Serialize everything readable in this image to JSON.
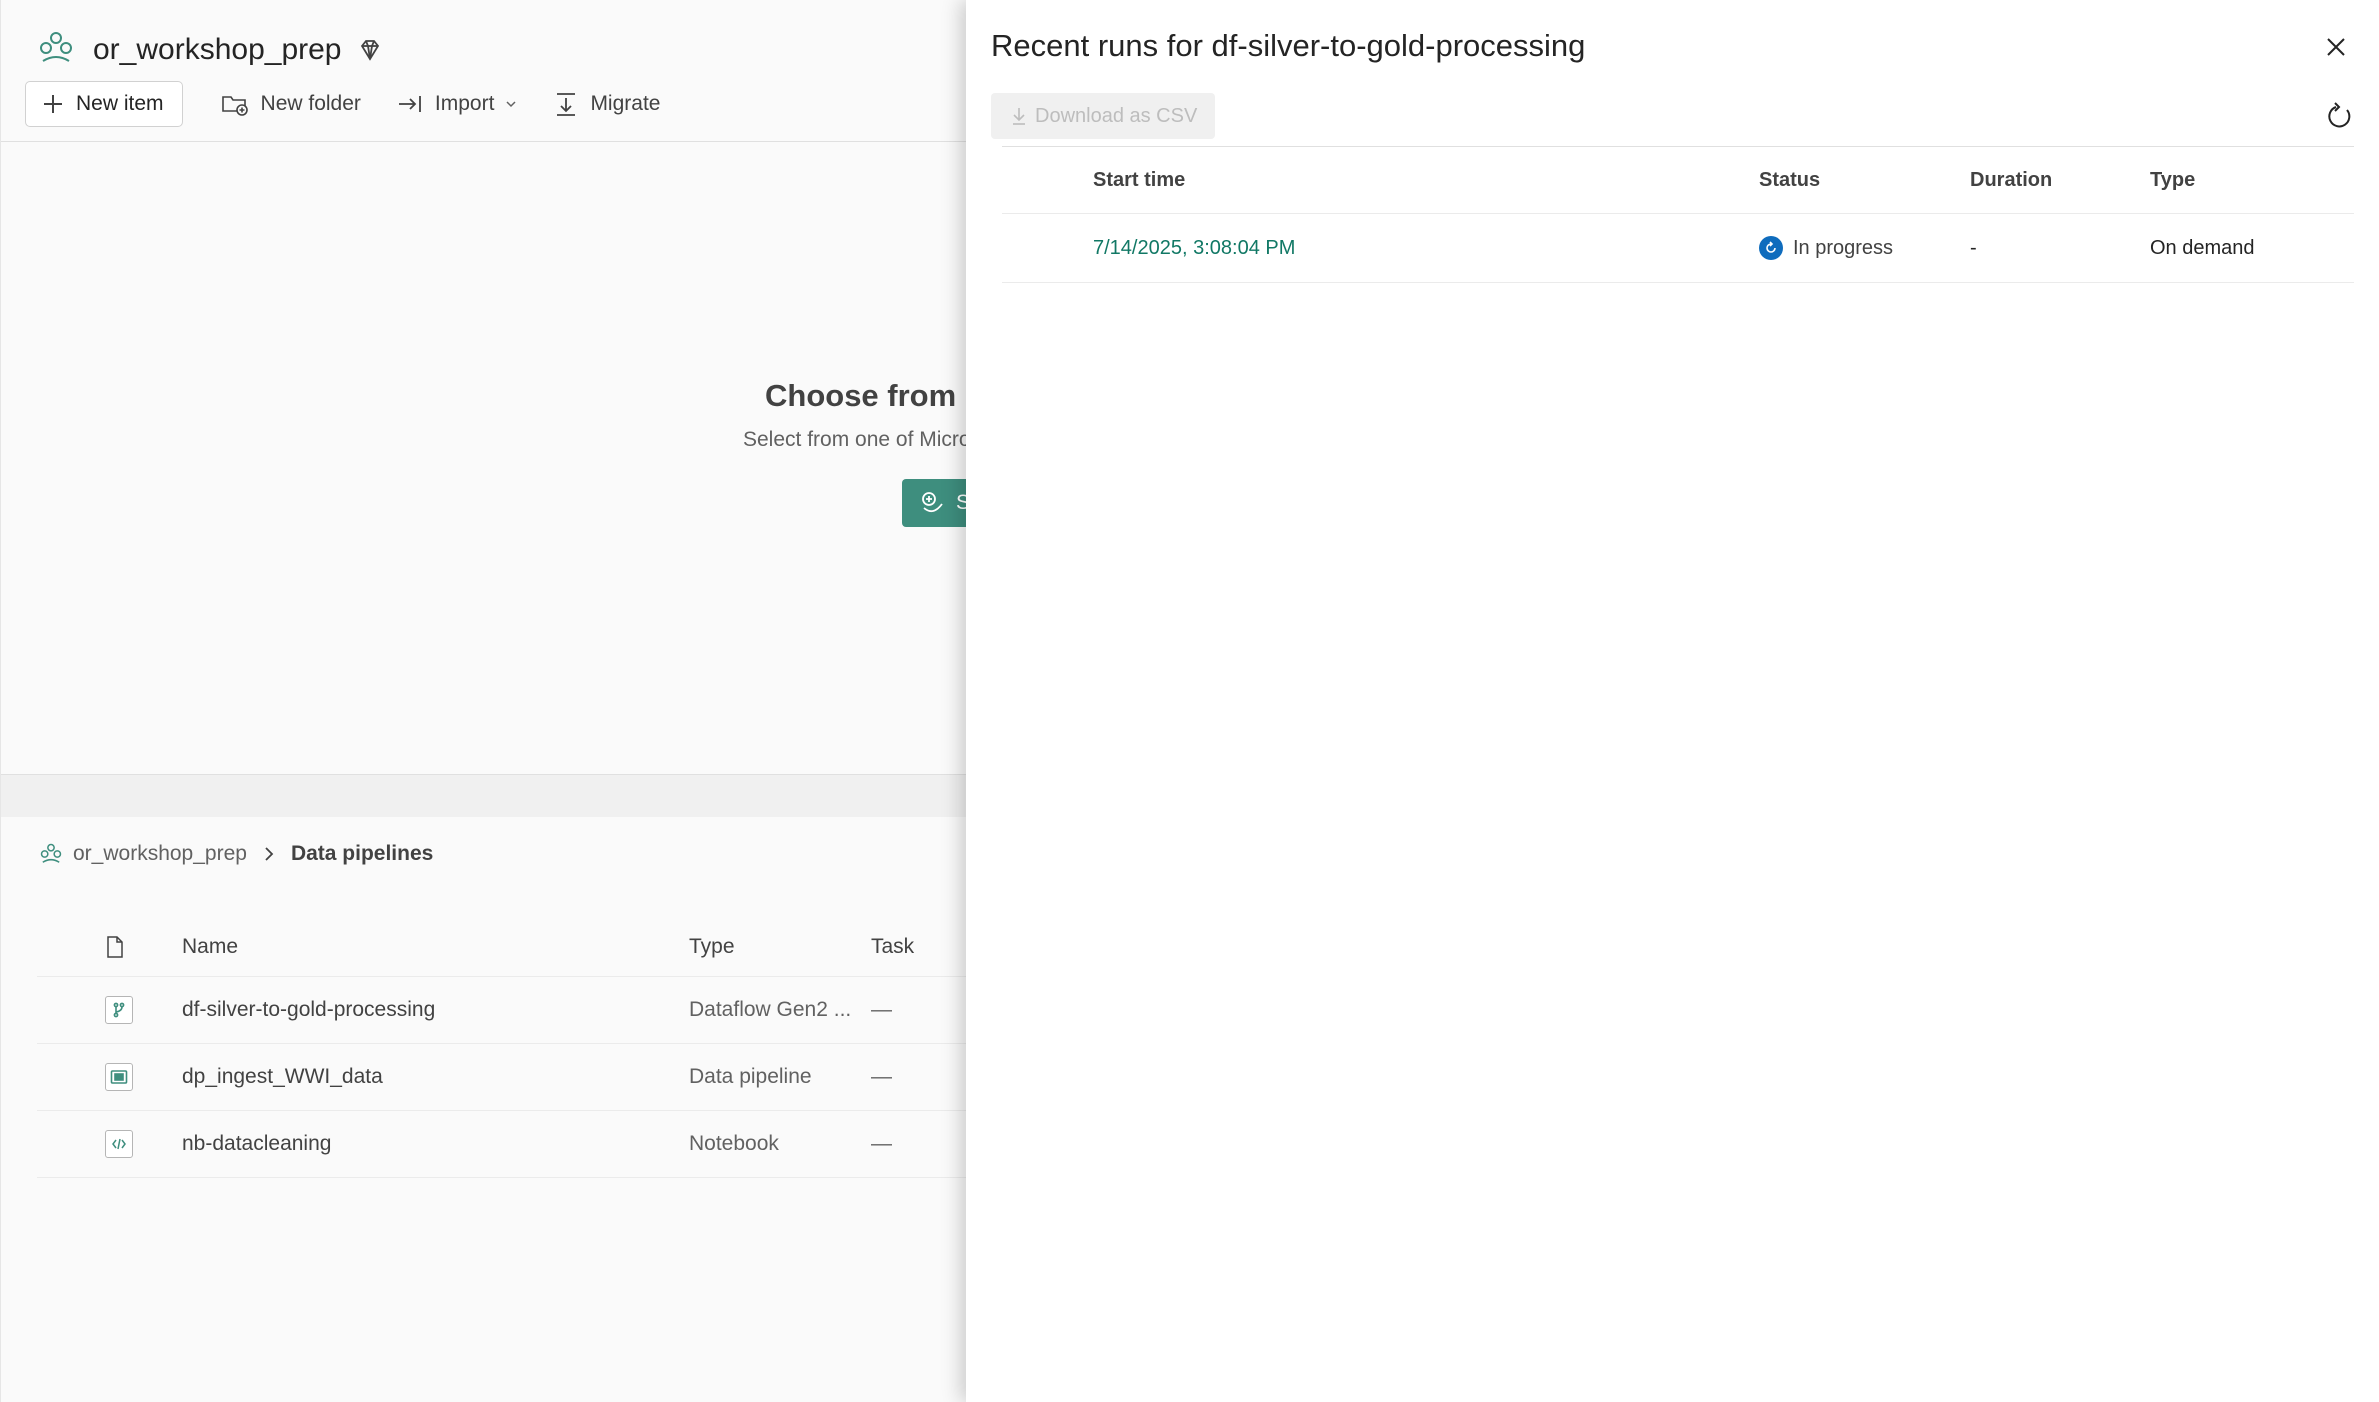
{
  "workspace": {
    "name": "or_workshop_prep",
    "toolbar": {
      "new_item": "New item",
      "new_folder": "New folder",
      "import": "Import",
      "migrate": "Migrate"
    },
    "empty_state": {
      "title": "Choose from p",
      "subtitle": "Select from one of Micro",
      "button_label": "S"
    },
    "breadcrumb": {
      "root": "or_workshop_prep",
      "current": "Data pipelines"
    },
    "table": {
      "columns": {
        "name": "Name",
        "type": "Type",
        "task": "Task"
      },
      "rows": [
        {
          "name": "df-silver-to-gold-processing",
          "type": "Dataflow Gen2 ...",
          "task": "—",
          "icon": "dataflow-icon"
        },
        {
          "name": "dp_ingest_WWI_data",
          "type": "Data pipeline",
          "task": "—",
          "icon": "pipeline-icon"
        },
        {
          "name": "nb-datacleaning",
          "type": "Notebook",
          "task": "—",
          "icon": "notebook-icon"
        }
      ]
    }
  },
  "panel": {
    "title": "Recent runs for df-silver-to-gold-processing",
    "download_label": "Download as CSV",
    "columns": {
      "start_time": "Start time",
      "status": "Status",
      "duration": "Duration",
      "type": "Type"
    },
    "runs": [
      {
        "start_time": "7/14/2025, 3:08:04 PM",
        "status": "In progress",
        "duration": "-",
        "type": "On demand"
      }
    ]
  },
  "colors": {
    "brand_teal": "#117865",
    "button_teal": "#3e8e7e",
    "status_blue": "#0f6cbd"
  }
}
